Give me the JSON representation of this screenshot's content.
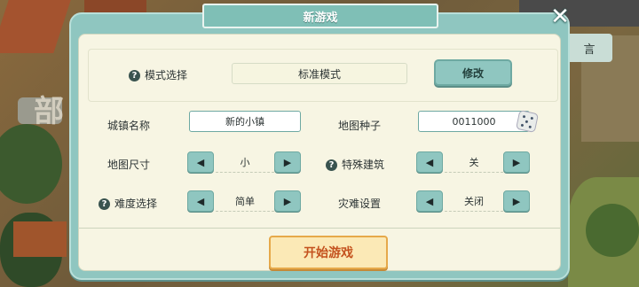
{
  "background": {
    "side_text": "部",
    "behind_button_label": "言"
  },
  "dialog": {
    "title": "新游戏",
    "close_icon": "close-icon",
    "mode": {
      "label": "模式选择",
      "value": "标准模式",
      "modify_label": "修改"
    },
    "town_name": {
      "label": "城镇名称",
      "value": "新的小镇"
    },
    "map_seed": {
      "label": "地图种子",
      "value": "0011000"
    },
    "map_size": {
      "label": "地图尺寸",
      "value": "小"
    },
    "special_buildings": {
      "label": "特殊建筑",
      "value": "关"
    },
    "difficulty": {
      "label": "难度选择",
      "value": "简单"
    },
    "disasters": {
      "label": "灾难设置",
      "value": "关闭"
    },
    "start_label": "开始游戏"
  },
  "colors": {
    "panel": "#8fc6c0",
    "inner": "#f7f5e3",
    "start_border": "#e6a94a",
    "start_text": "#c4521e"
  }
}
